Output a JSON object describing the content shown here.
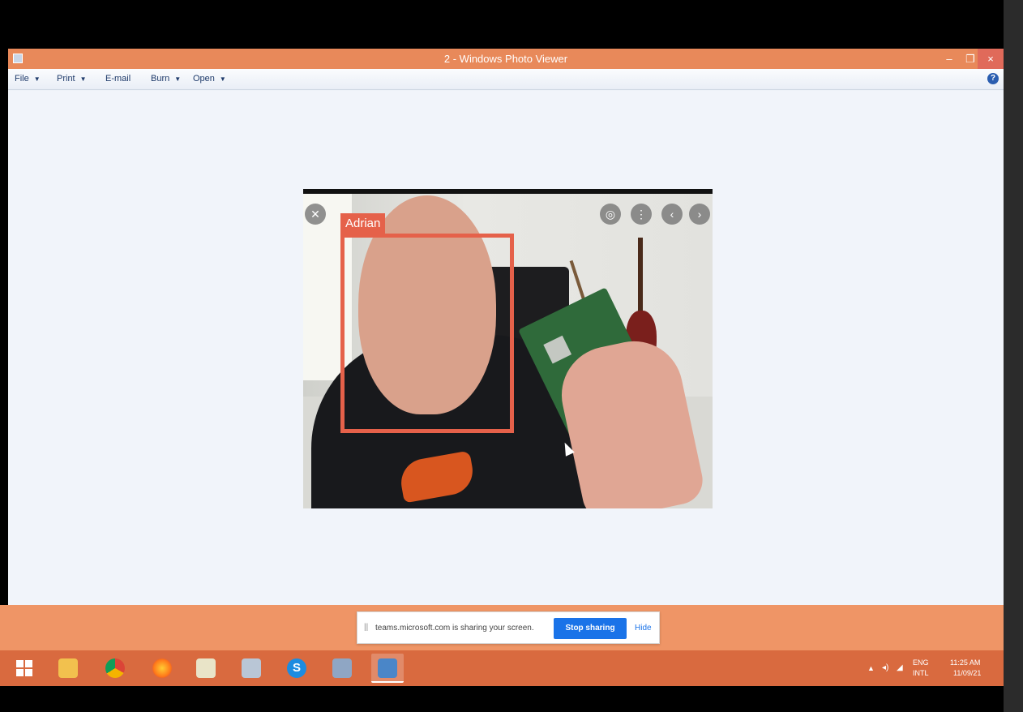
{
  "window": {
    "title": "2 - Windows Photo Viewer",
    "controls": {
      "minimize": "–",
      "maximize": "❐",
      "close": "×"
    }
  },
  "menu": {
    "items": [
      {
        "label": "File"
      },
      {
        "label": "Print"
      },
      {
        "label": "E-mail"
      },
      {
        "label": "Burn"
      },
      {
        "label": "Open"
      }
    ],
    "caret": "▼",
    "help": "?"
  },
  "photo": {
    "face_label": "Adrian",
    "overlay_buttons": {
      "close": "✕",
      "lens": "◎",
      "more": "⋮",
      "prev": "‹",
      "next": "›"
    }
  },
  "share_bar": {
    "grip": "||",
    "message": "teams.microsoft.com is sharing your screen.",
    "stop_label": "Stop sharing",
    "hide_label": "Hide"
  },
  "taskbar": {
    "apps": [
      {
        "name": "file-explorer",
        "color": "#f2c14e"
      },
      {
        "name": "chrome",
        "color": "#f4b400"
      },
      {
        "name": "firefox",
        "color": "#ff7a1a"
      },
      {
        "name": "notepad",
        "color": "#e9e4c8"
      },
      {
        "name": "paint",
        "color": "#b9c6d6"
      },
      {
        "name": "skype",
        "color": "#1d8ce0"
      },
      {
        "name": "settings",
        "color": "#8fa6c4"
      },
      {
        "name": "photo-viewer",
        "color": "#4a86c8"
      }
    ],
    "tray": {
      "arrow": "▲",
      "volume": "◂)",
      "network": "◢",
      "lang_line1": "ENG",
      "lang_line2": "INTL",
      "time": "11:25 AM",
      "date": "11/09/21"
    }
  },
  "colors": {
    "titlebar": "#e8895a",
    "taskbar": "#d96a3f",
    "face_box": "#e5614a",
    "stop_button": "#1a73e8"
  }
}
